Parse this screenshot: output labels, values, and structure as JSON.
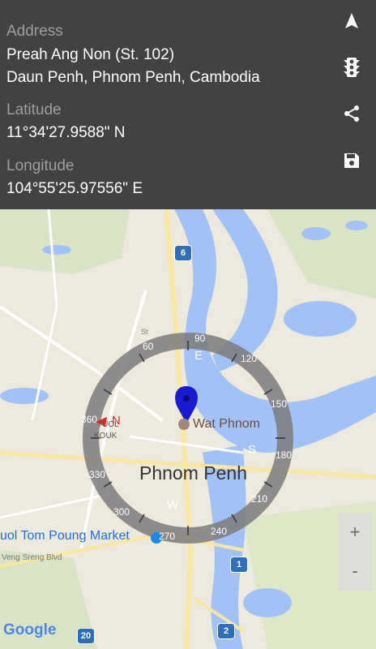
{
  "info": {
    "address_label": "Address",
    "address_line1": "Preah Ang Non (St. 102)",
    "address_line2": "Daun Penh, Phnom Penh, Cambodia",
    "latitude_label": "Latitude",
    "latitude_value": "11°34'27.9588\" N",
    "longitude_label": "Longitude",
    "longitude_value": "104°55'25.97556\" E"
  },
  "actions": [
    "navigate-icon",
    "traffic-light-icon",
    "share-icon",
    "save-icon"
  ],
  "map": {
    "city_label": "Phnom Penh",
    "poi_wat_phnom": "Wat Phnom",
    "poi_market": "uol Tom Poung Market",
    "poi_tuol_kouk_line1": "TUOL",
    "poi_tuol_kouk_line2": "KOUK",
    "road_label": "Veng Sreng Blvd",
    "road_label_small": "St",
    "route_shields": [
      "6",
      "1",
      "20",
      "2"
    ],
    "zoom_in": "+",
    "zoom_out": "-",
    "logo": "Google",
    "colors": {
      "water": "#a2c2f7",
      "land": "#ede9dc",
      "road": "#fbe7a1",
      "park": "#cde6b9",
      "pin": "#1a1ad0"
    }
  },
  "compass": {
    "degree_labels": [
      "90",
      "120",
      "150",
      "180",
      "210",
      "240",
      "270",
      "300",
      "330",
      "360",
      "60"
    ],
    "cardinal": {
      "north": "N",
      "east": "E",
      "south": "S",
      "west": "W"
    }
  }
}
